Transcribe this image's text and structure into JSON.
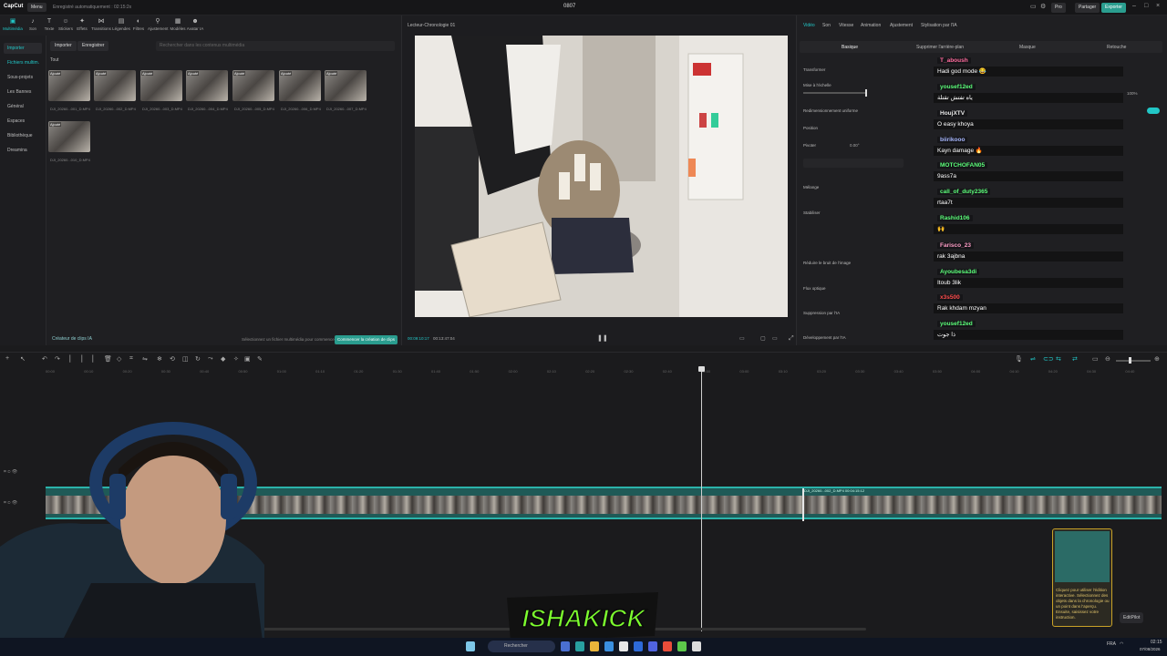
{
  "titlebar": {
    "app_name": "CapCut",
    "menu_label": "Menu",
    "autosave": "Enregistré automatiquement : 02:15:2x",
    "project_title": "0807",
    "pro_label": "Pro",
    "share_label": "Partager",
    "export_label": "Exporter"
  },
  "toolbar": {
    "items": [
      "Multimédia",
      "Son",
      "Texte",
      "Stickers",
      "Effets",
      "Transitions",
      "Légendes",
      "Filtres",
      "Ajustement",
      "Modèles",
      "Avatar IA"
    ]
  },
  "sidebar": {
    "items": [
      "Importer",
      "Fichiers multim.",
      "Sous-projets",
      "Les Bannes",
      "Général",
      "Espaces",
      "Bibliothèque",
      "Dreamina"
    ]
  },
  "media": {
    "import_label": "Importer",
    "record_label": "Enregistrer",
    "search_placeholder": "Rechercher dans les contenus multimédia",
    "all_label": "Tout",
    "badge": "Ajouté",
    "items": [
      "DJI_20260...001_D.MP4",
      "DJI_20260...002_D.MP4",
      "DJI_20260...003_D.MP4",
      "DJI_20260...004_D.MP4",
      "DJI_20260...005_D.MP4",
      "DJI_20260...006_D.MP4",
      "DJI_20260...007_D.MP4",
      "DJI_20260...010_D.MP4"
    ],
    "clip_creator": "Créateur de clips IA",
    "select_hint": "Sélectionnez un fichier multimédia pour commencer",
    "start_button": "Commencer la création de clips"
  },
  "player": {
    "title": "Lecteur-Chronologie 01",
    "timecode": "00:09:10:17",
    "duration": "00:13:47:04"
  },
  "properties": {
    "tabs": [
      "Vidéo",
      "Son",
      "Vitesse",
      "Animation",
      "Ajustement",
      "Stylisation par l'IA"
    ],
    "subtabs": [
      "Basique",
      "Supprimer l'arrière-plan",
      "Masque",
      "Retouche"
    ],
    "labels": [
      "Transformer",
      "Mise à l'échelle",
      "Redimensionnement uniforme",
      "Position",
      "Pivoter",
      "Mélange",
      "Stabiliser",
      "Réduire le bruit de l'image",
      "Flux optique",
      "Suppression par l'IA",
      "Développement par l'IA"
    ],
    "scale_value": "100%",
    "rotate_value": "0.00°"
  },
  "chat": [
    {
      "user": "T_aboush",
      "color": "#ff6b9d",
      "msg": "Hadi god mode 😂"
    },
    {
      "user": "yousef12ed",
      "color": "#5cff7a",
      "msg": "ياه تفتش تقتلة"
    },
    {
      "user": "HoujXTV",
      "color": "#e8e8e8",
      "msg": "O easy khoya"
    },
    {
      "user": "biirikooo",
      "color": "#a8b8ff",
      "msg": "Kayn damage 🔥"
    },
    {
      "user": "MOTCHOFAN05",
      "color": "#5cff7a",
      "msg": "9ass7a"
    },
    {
      "user": "call_of_duty2365",
      "color": "#5cff7a",
      "msg": "rtaa7t"
    },
    {
      "user": "Rashid106",
      "color": "#5cff7a",
      "msg": "🙌"
    },
    {
      "user": "Farisco_23",
      "color": "#ff9ec7",
      "msg": "rak 3ajbna"
    },
    {
      "user": "Ayoubesa3di",
      "color": "#5cff7a",
      "msg": "Itoub 3lik"
    },
    {
      "user": "x3s500",
      "color": "#ff4d4d",
      "msg": "Rak khdam mzyan"
    },
    {
      "user": "yousef12ed",
      "color": "#5cff7a",
      "msg": "ذا جوت"
    }
  ],
  "timeline": {
    "ruler": [
      "00:00",
      "00:10",
      "00:20",
      "00:30",
      "00:40",
      "00:50",
      "01:00",
      "01:10",
      "01:20",
      "01:30",
      "01:40",
      "01:50",
      "02:00",
      "02:10",
      "02:20",
      "02:30",
      "02:40",
      "02:50",
      "03:00",
      "03:10",
      "03:20",
      "03:30",
      "03:40",
      "03:50",
      "04:00",
      "04:10",
      "04:20",
      "04:30",
      "04:40"
    ],
    "clip_name": "DJI_20260...002_D.MP4   00:04:15:12"
  },
  "overlay": {
    "logo_text": "ISHAKICK",
    "ai_panel_text": "Cliquez pour utiliser l'édition interactive. Sélectionnez des objets dans la chronologie ou un point dans l'aperçu. Ensuite, saisissez votre instruction.",
    "editpilot_label": "EditPilot"
  },
  "taskbar": {
    "search_placeholder": "Rechercher",
    "lang": "FRA",
    "time": "02:15",
    "date": "07/08/2026"
  }
}
